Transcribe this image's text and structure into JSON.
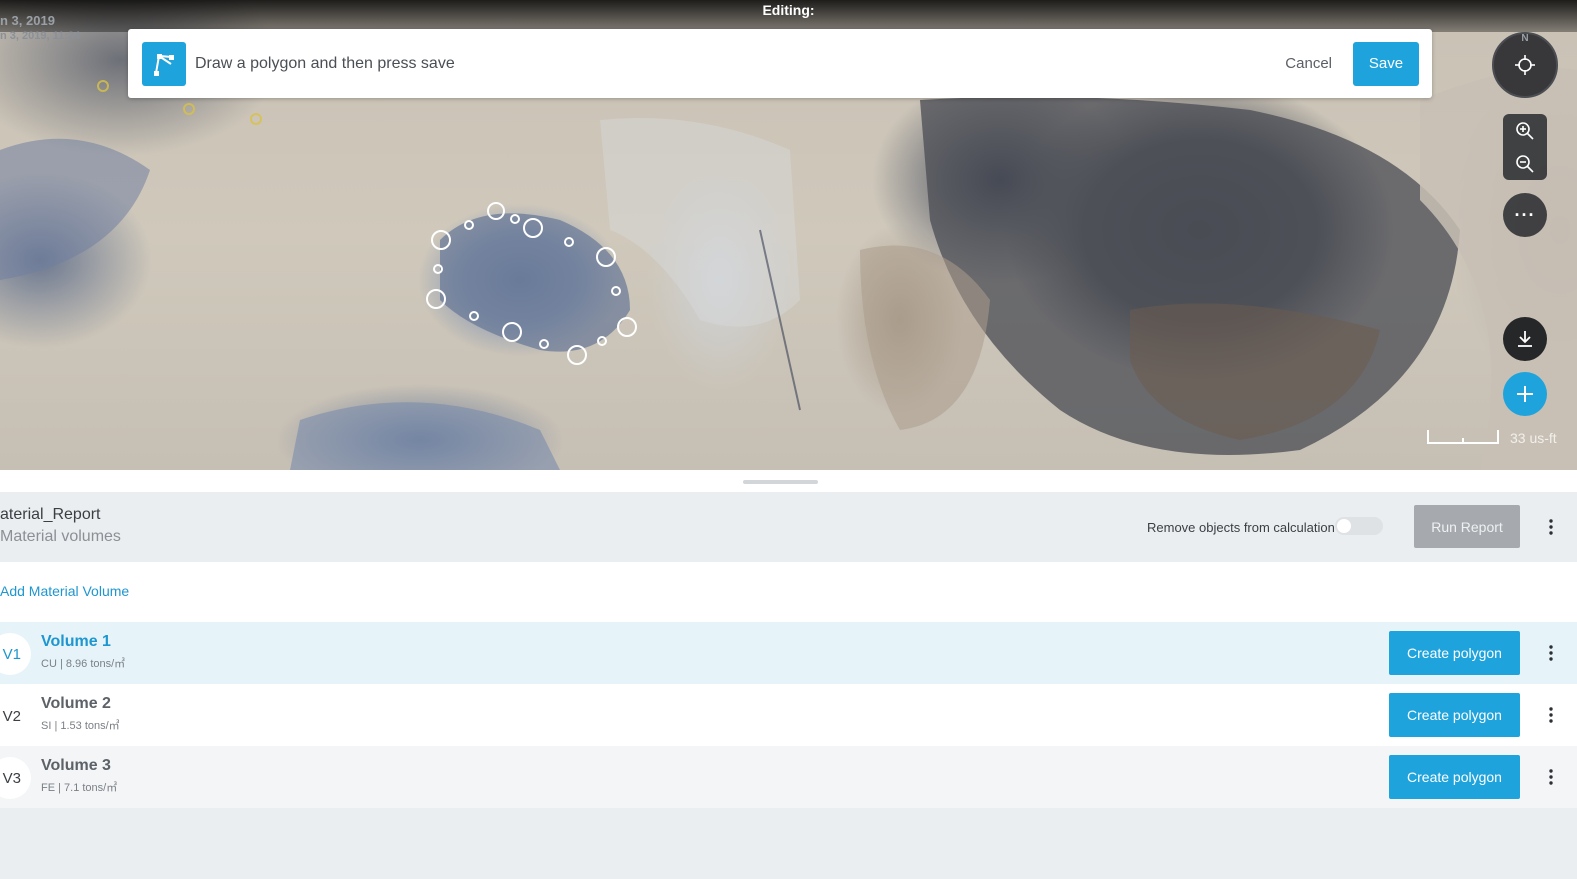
{
  "map": {
    "date": "n 3, 2019",
    "datetime": "n 3, 2019, 11:24",
    "editing_label": "Editing:",
    "scale_label": "33 us-ft"
  },
  "edit_bar": {
    "icon": "polygon-draw-icon",
    "message": "Draw a polygon and then press save",
    "cancel_label": "Cancel",
    "save_label": "Save"
  },
  "controls": {
    "compass_label": "N",
    "more_label": "···",
    "icons": [
      "locate-icon",
      "zoom-in-icon",
      "zoom-out-icon",
      "more-icon",
      "download-icon",
      "plus-icon"
    ]
  },
  "report": {
    "name": "aterial_Report",
    "subtitle": "Material volumes",
    "remove_objects_label": "Remove objects from calculation",
    "remove_objects_enabled": false,
    "run_report_label": "Run Report",
    "add_material_label": "Add Material Volume"
  },
  "volumes": [
    {
      "badge": "V1",
      "name": "Volume 1",
      "meta": "CU | 8.96 tons/㎥",
      "button": "Create polygon",
      "active": true
    },
    {
      "badge": "V2",
      "name": "Volume 2",
      "meta": "SI | 1.53 tons/㎥",
      "button": "Create polygon",
      "active": false
    },
    {
      "badge": "V3",
      "name": "Volume 3",
      "meta": "FE | 7.1 tons/㎥",
      "button": "Create polygon",
      "active": false
    }
  ],
  "colors": {
    "accent": "#1ea3dc",
    "link": "#1e96cf",
    "disabled_button": "#a6aaae"
  }
}
